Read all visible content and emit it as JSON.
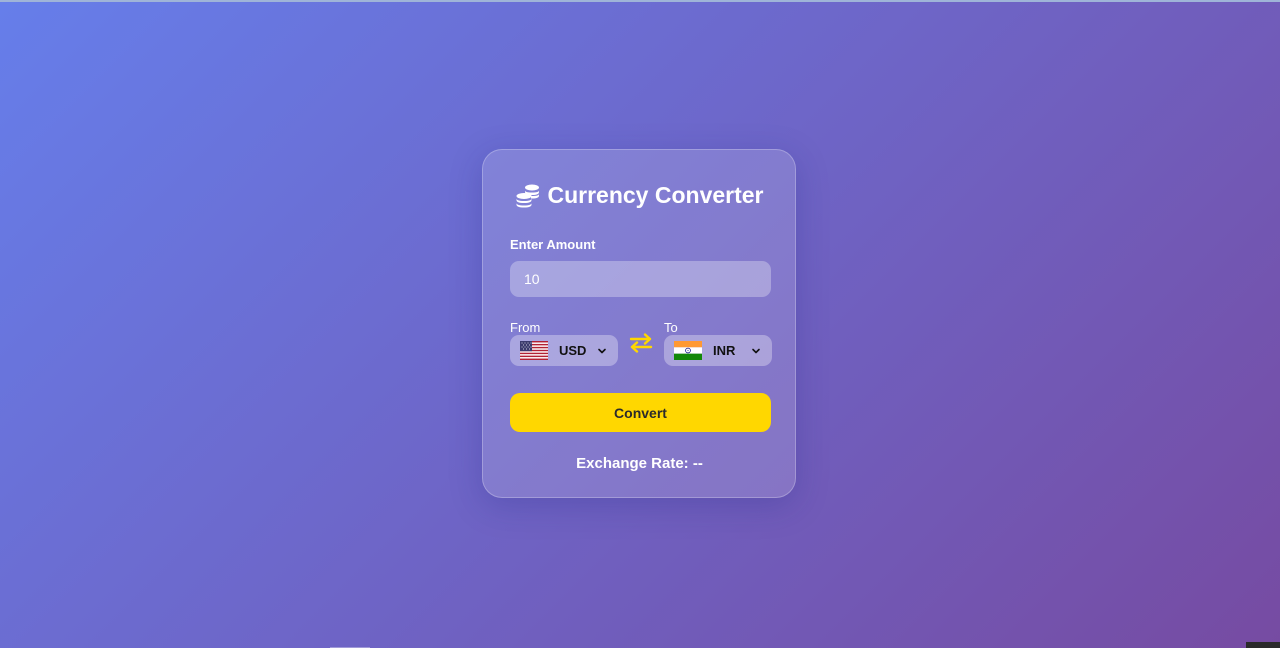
{
  "app": {
    "title": "Currency Converter",
    "title_icon": "coins-icon"
  },
  "amount": {
    "label": "Enter Amount",
    "value": "10"
  },
  "from": {
    "label": "From",
    "code": "USD",
    "flag": "us-flag-icon"
  },
  "to": {
    "label": "To",
    "code": "INR",
    "flag": "india-flag-icon"
  },
  "swap_icon": "swap-arrows-icon",
  "convert": {
    "label": "Convert"
  },
  "rate": {
    "text": "Exchange Rate: --"
  },
  "colors": {
    "gradient_start": "#667eea",
    "gradient_end": "#764ba2",
    "accent": "#ffd700"
  }
}
